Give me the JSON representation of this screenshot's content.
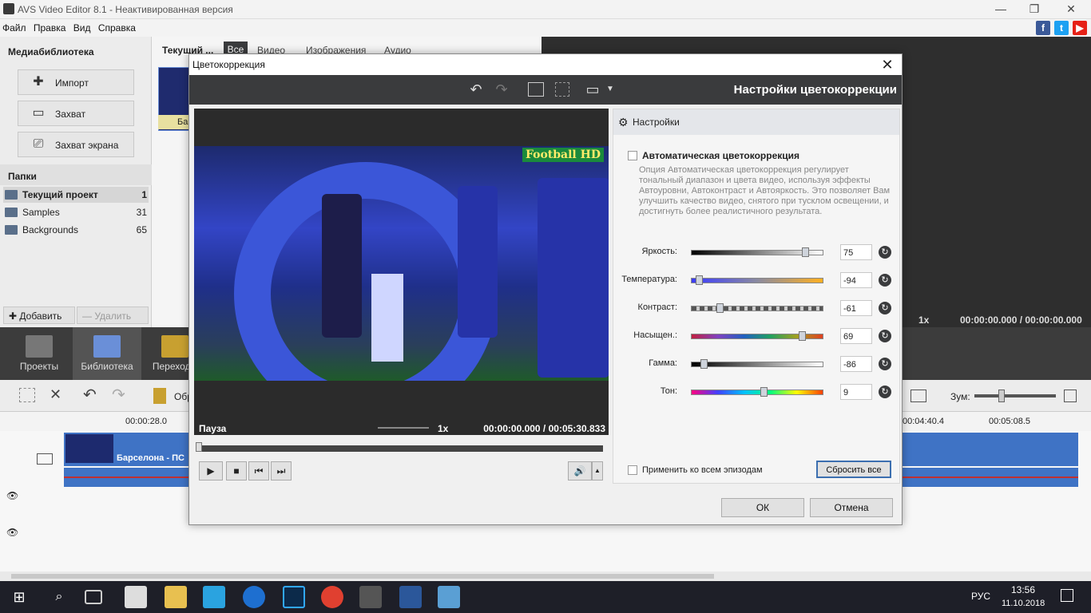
{
  "app": {
    "title": "AVS Video Editor 8.1 - Неактивированная версия"
  },
  "menu": [
    "Файл",
    "Правка",
    "Вид",
    "Справка"
  ],
  "left_panel": {
    "media_header": "Медиабиблиотека",
    "buttons": [
      "Импорт",
      "Захват",
      "Захват экрана"
    ],
    "folders_header": "Папки",
    "folders": [
      {
        "name": "Текущий проект",
        "count": "1"
      },
      {
        "name": "Samples",
        "count": "31"
      },
      {
        "name": "Backgrounds",
        "count": "65"
      }
    ],
    "add_label": "Добавить",
    "delete_label": "Удалить"
  },
  "library": {
    "current_tab": "Текущий ...",
    "tabs": [
      "Все",
      "Видео",
      "Изображения",
      "Аудио"
    ],
    "thumb_label": "Ба"
  },
  "nav_tabs": [
    "Проекты",
    "Библиотека",
    "Переходы"
  ],
  "main_preview": {
    "speed": "1x",
    "time": "00:00:00.000 / 00:00:00.000"
  },
  "timeline": {
    "ruler_labels": [
      "00:00:28.0",
      "00:04:40.4",
      "00:05:08.5"
    ],
    "clip_title": "Барселона - ПС",
    "zoom_label": "Зум:",
    "toolbar_fragment": "Обр"
  },
  "dialog": {
    "title": "Цветокоррекция",
    "header": "Настройки цветокоррекции",
    "preview": {
      "status": "Пауза",
      "speed": "1x",
      "time": "00:00:00.000 / 00:05:30.833",
      "watermark": "Football HD"
    },
    "settings_header": "Настройки",
    "auto_label": "Автоматическая цветокоррекция",
    "auto_desc": "Опция Автоматическая цветокоррекция регулирует тональный диапазон и цвета видео, используя эффекты Автоуровни, Автоконтраст и Автояркость. Это позволяет Вам улучшить качество видео, снятого при тусклом освещении, и достигнуть более реалистичного результата.",
    "sliders": [
      {
        "label": "Яркость:",
        "value": "75",
        "level": 0.875
      },
      {
        "label": "Температура:",
        "value": "-94",
        "level": 0.03
      },
      {
        "label": "Контраст:",
        "value": "-61",
        "level": 0.195
      },
      {
        "label": "Насыщен.:",
        "value": "69",
        "level": 0.845
      },
      {
        "label": "Гамма:",
        "value": "-86",
        "level": 0.07
      },
      {
        "label": "Тон:",
        "value": "9",
        "level": 0.545
      }
    ],
    "apply_all_label": "Применить ко всем эпизодам",
    "reset_all": "Сбросить все",
    "ok": "ОК",
    "cancel": "Отмена"
  },
  "taskbar": {
    "time": "13:56",
    "date": "11.10.2018",
    "lang": "РУС"
  },
  "colors": {
    "accent": "#3f73c5",
    "dialog_header": "#3a3b3d"
  }
}
